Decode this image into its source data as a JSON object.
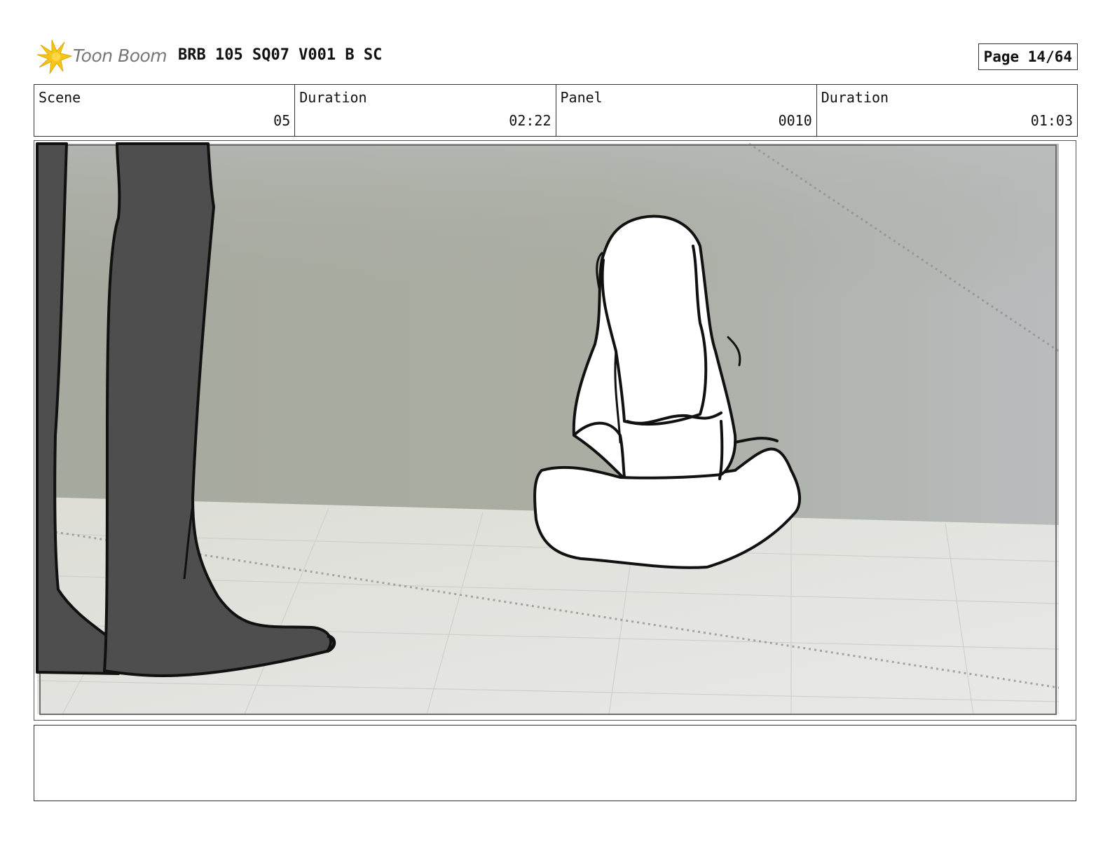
{
  "header": {
    "logo_text": "Toon Boom",
    "title": "BRB 105 SQ07 V001 B SC",
    "page_label": "Page 14/64"
  },
  "info": {
    "scene_label": "Scene",
    "scene_value": "05",
    "scene_duration_label": "Duration",
    "scene_duration_value": "02:22",
    "panel_label": "Panel",
    "panel_value": "0010",
    "panel_duration_label": "Duration",
    "panel_duration_value": "01:03"
  },
  "notes": {
    "text": ""
  },
  "colors": {
    "logo_accent": "#f5c518",
    "wall": "#a8aba0",
    "floor": "#e4e4df",
    "legs": "#4d4d4d",
    "line": "#111111"
  },
  "icons": {
    "logo": "toon-boom-starburst-icon"
  }
}
